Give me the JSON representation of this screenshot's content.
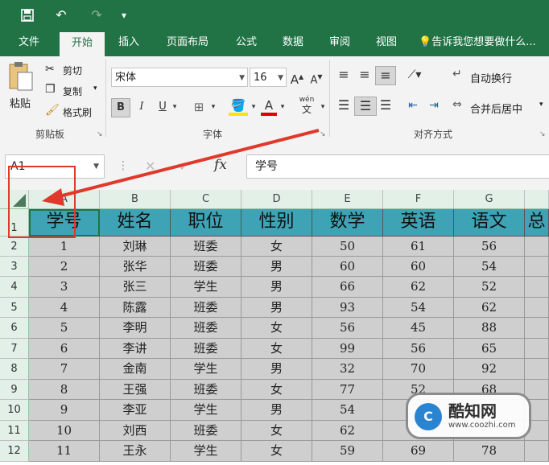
{
  "quick_access": {
    "undo_label": "↶",
    "redo_label": "↷",
    "customize_label": "▾"
  },
  "tabs": [
    "文件",
    "开始",
    "插入",
    "页面布局",
    "公式",
    "数据",
    "审阅",
    "视图"
  ],
  "tell_me": "告诉我您想要做什么...",
  "ribbon": {
    "clipboard": {
      "paste": "粘贴",
      "cut": "剪切",
      "copy": "复制",
      "format_painter": "格式刷",
      "label": "剪贴板"
    },
    "font": {
      "name": "宋体",
      "size": "16",
      "bold": "B",
      "italic": "I",
      "underline": "U",
      "label": "字体",
      "phonetic": "wén"
    },
    "alignment": {
      "wrap_text": "自动换行",
      "merge_center": "合并后居中",
      "label": "对齐方式"
    }
  },
  "formula_bar": {
    "name_box": "A1",
    "fx": "fx",
    "value": "学号"
  },
  "columns": [
    "A",
    "B",
    "C",
    "D",
    "E",
    "F",
    "G"
  ],
  "headers": [
    "学号",
    "姓名",
    "职位",
    "性别",
    "数学",
    "英语",
    "语文",
    "总"
  ],
  "rows": [
    [
      "1",
      "刘琳",
      "班委",
      "女",
      "50",
      "61",
      "56"
    ],
    [
      "2",
      "张华",
      "班委",
      "男",
      "60",
      "60",
      "54"
    ],
    [
      "3",
      "张三",
      "学生",
      "男",
      "66",
      "62",
      "52"
    ],
    [
      "4",
      "陈露",
      "班委",
      "男",
      "93",
      "54",
      "62"
    ],
    [
      "5",
      "李明",
      "班委",
      "女",
      "56",
      "45",
      "88"
    ],
    [
      "6",
      "李讲",
      "班委",
      "女",
      "99",
      "56",
      "65"
    ],
    [
      "7",
      "金南",
      "学生",
      "男",
      "32",
      "70",
      "92"
    ],
    [
      "8",
      "王强",
      "班委",
      "女",
      "77",
      "52",
      "68"
    ],
    [
      "9",
      "李亚",
      "学生",
      "男",
      "54",
      "",
      ""
    ],
    [
      "10",
      "刘西",
      "班委",
      "女",
      "62",
      "",
      ""
    ],
    [
      "11",
      "王永",
      "学生",
      "女",
      "59",
      "69",
      "78"
    ]
  ],
  "row_numbers": [
    "1",
    "2",
    "3",
    "4",
    "5",
    "6",
    "7",
    "8",
    "9",
    "10",
    "11",
    "12"
  ],
  "watermark": {
    "brand": "酷知网",
    "url": "www.coozhi.com"
  },
  "colors": {
    "excel_green": "#217346",
    "header_fill": "#3ea3b5",
    "body_fill": "#cfcfcf",
    "annotation": "#e0392b"
  }
}
